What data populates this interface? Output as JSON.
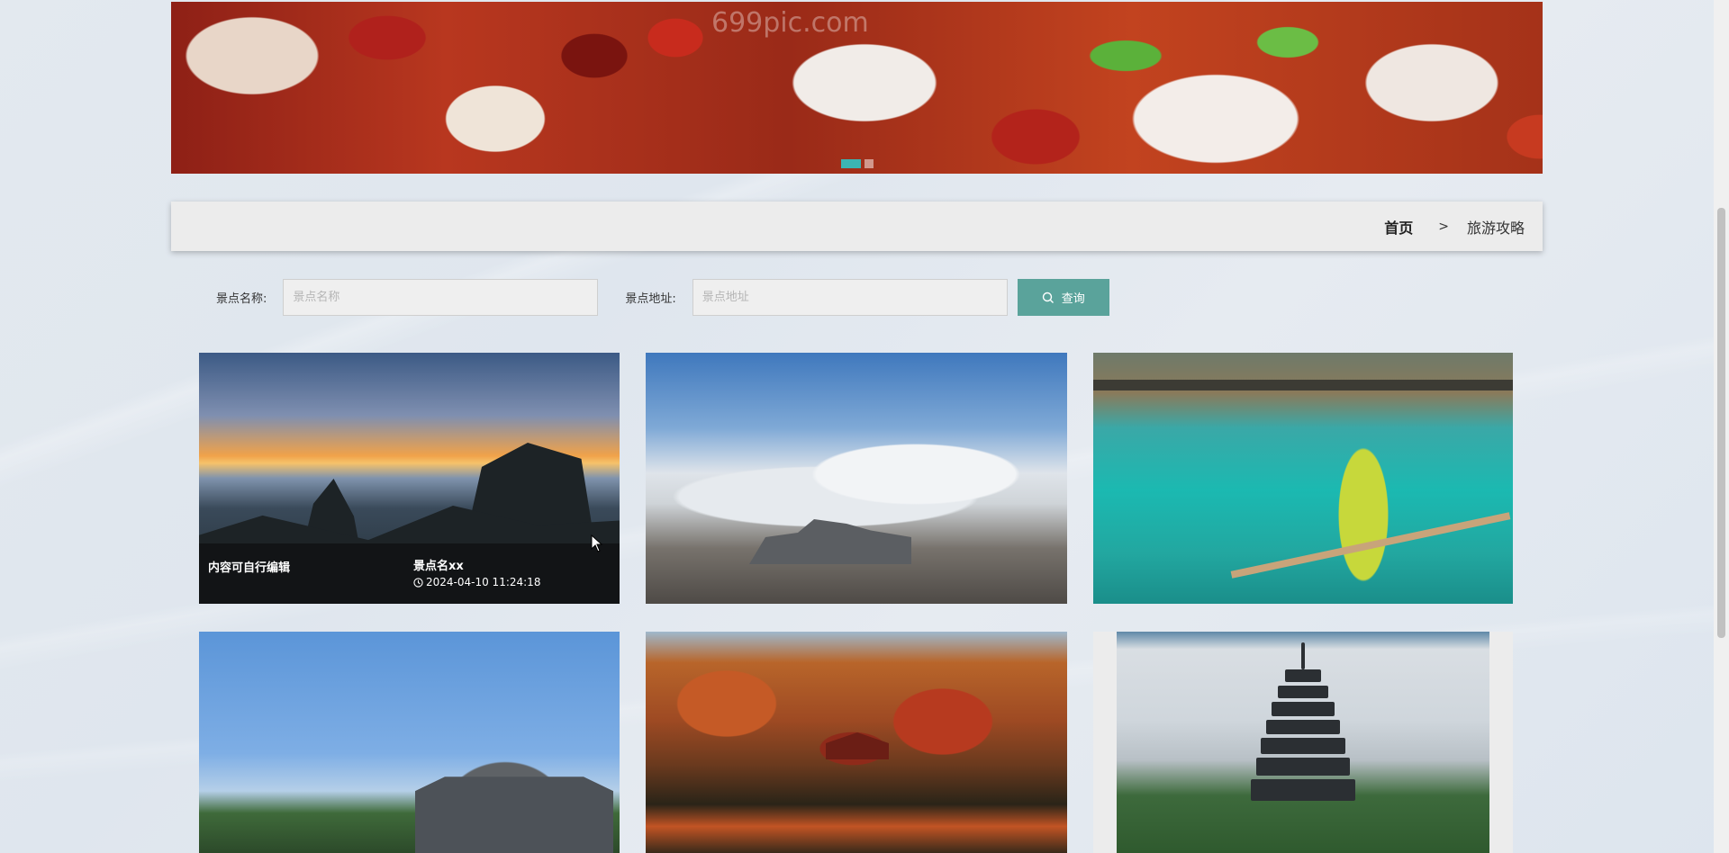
{
  "banner": {
    "watermark": "699pic.com",
    "dots": 2,
    "active_dot": 0
  },
  "breadcrumb": {
    "home": "首页",
    "separator": ">",
    "current": "旅游攻略"
  },
  "search": {
    "name_label": "景点名称:",
    "name_placeholder": "景点名称",
    "name_value": "",
    "address_label": "景点地址:",
    "address_placeholder": "景点地址",
    "address_value": "",
    "button_label": "查询",
    "button_color": "#5aa39b"
  },
  "cards": [
    {
      "hovered": true,
      "description": "内容可自行编辑",
      "name": "景点名xx",
      "time": "2024-04-10 11:24:18"
    },
    {},
    {},
    {},
    {},
    {}
  ],
  "colors": {
    "accent": "#3bb5b2",
    "breadcrumb_bg": "#ececec"
  }
}
